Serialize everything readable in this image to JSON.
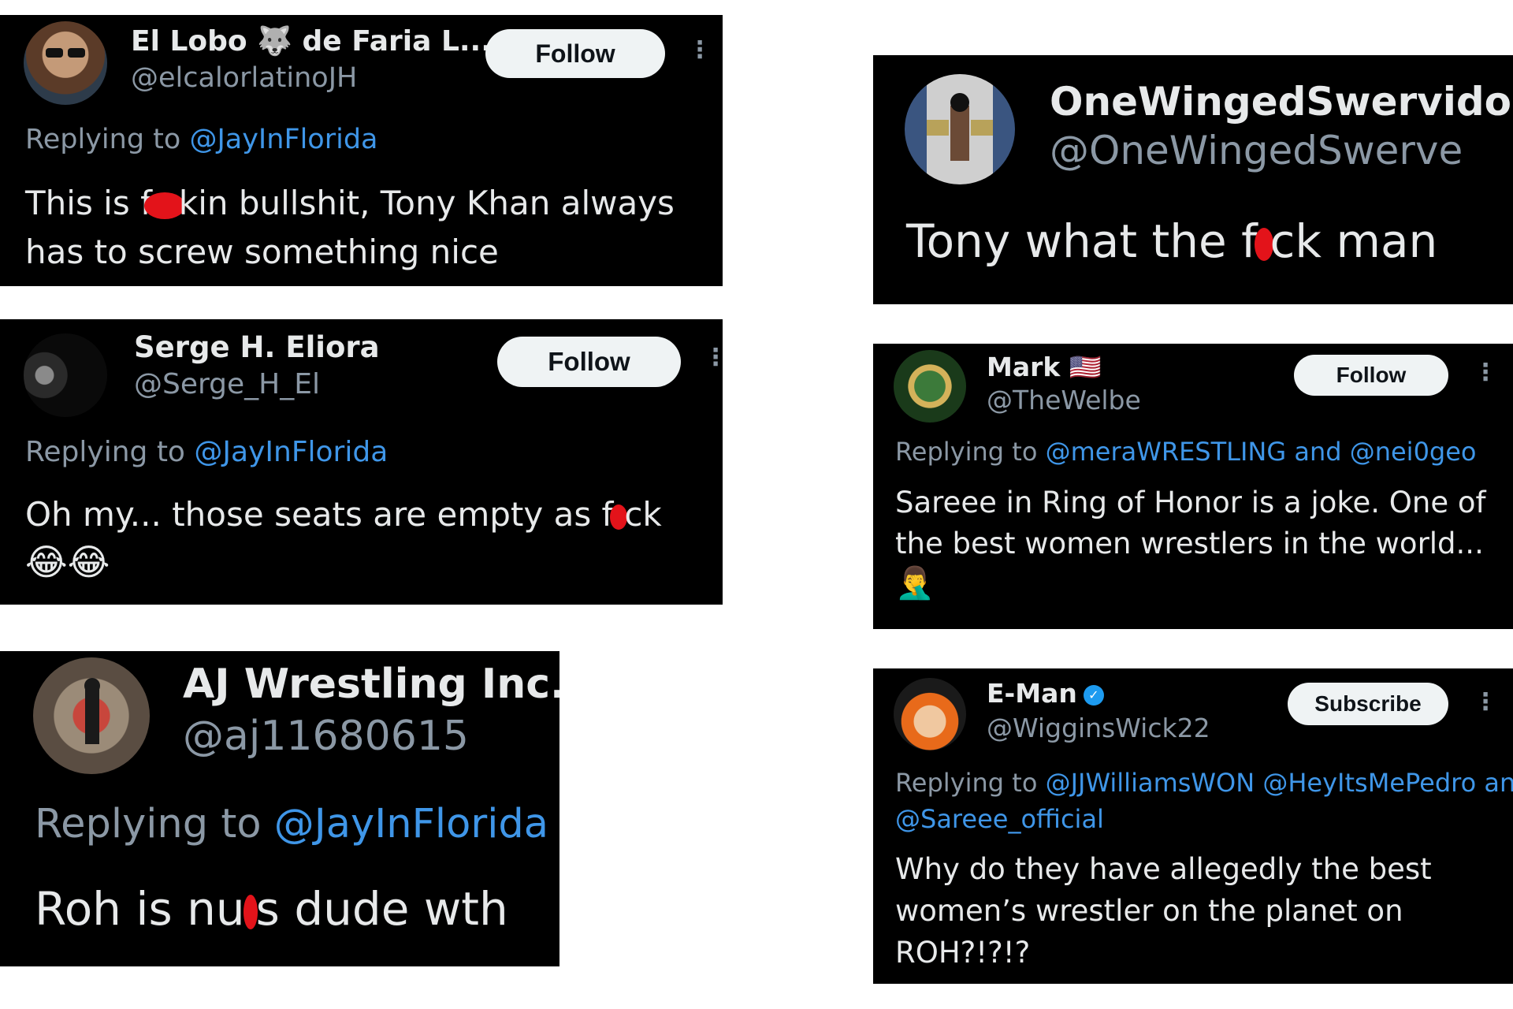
{
  "tweets": [
    {
      "name": "El Lobo 🐺 de Faria L...",
      "handle": "@elcalorlatinoJH",
      "button": "Follow",
      "reply_prefix": "Replying to ",
      "reply_to": "@JayInFlorida",
      "text_before": "This is f",
      "text_after": "kin bullshit, Tony Khan always has to screw something nice"
    },
    {
      "name": "Serge H. Eliora",
      "handle": "@Serge_H_El",
      "button": "Follow",
      "reply_prefix": "Replying to ",
      "reply_to": "@JayInFlorida",
      "text_before": "Oh my... those seats are empty as f",
      "text_after": "ck",
      "emoji": "😂😂"
    },
    {
      "name": "AJ Wrestling Inc.",
      "handle": "@aj11680615",
      "reply_prefix": "Replying to ",
      "reply_to": "@JayInFlorida",
      "text_before": "Roh is nu",
      "text_after": "s dude wth"
    },
    {
      "name": "OneWingedSwervido",
      "handle": "@OneWingedSwerve",
      "text_before": "Tony what the f",
      "text_after": "ck man"
    },
    {
      "name": "Mark 🇺🇸",
      "handle": "@TheWelbe",
      "button": "Follow",
      "reply_prefix": "Replying to ",
      "reply_to": "@meraWRESTLING and @nei0geo",
      "text": "Sareee in Ring of Honor is a joke. One of the best women wrestlers in the world...",
      "emoji": "🤦‍♂️"
    },
    {
      "name": "E-Man",
      "handle": "@WigginsWick22",
      "button": "Subscribe",
      "reply_prefix": "Replying to ",
      "reply_to": "@JJWilliamsWON @HeyItsMePedro and",
      "reply_to_line2": "@Sareee_official",
      "text": "Why do they have allegedly the best women’s wrestler on the planet on ROH?!?!?"
    }
  ],
  "more_icon": "⋮"
}
